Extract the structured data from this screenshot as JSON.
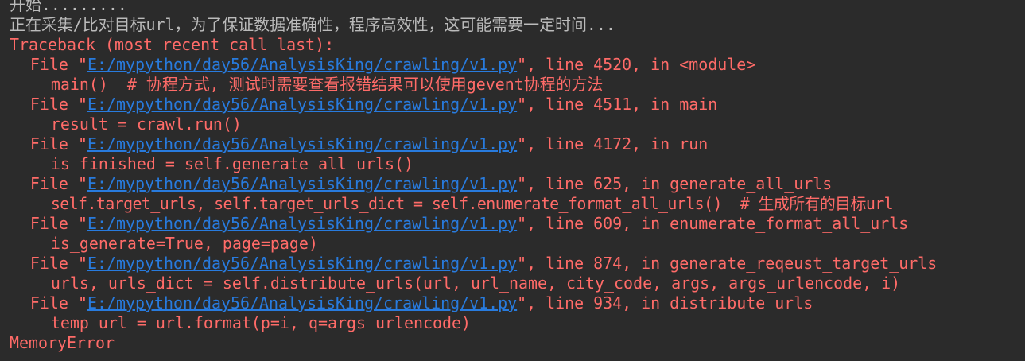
{
  "console": {
    "partial_top_line": "开始.........",
    "status_line": "正在采集/比对目标url，为了保证数据准确性，程序高效性，这可能需要一定时间...",
    "traceback_header": "Traceback (most recent call last):",
    "frames": [
      {
        "file_prefix": "File \"",
        "path": "E:/mypython/day56/AnalysisKing/crawling/v1.py",
        "suffix": "\", line 4520, in <module>",
        "code": "main()  # 协程方式, 测试时需要查看报错结果可以使用gevent协程的方法"
      },
      {
        "file_prefix": "File \"",
        "path": "E:/mypython/day56/AnalysisKing/crawling/v1.py",
        "suffix": "\", line 4511, in main",
        "code": "result = crawl.run()"
      },
      {
        "file_prefix": "File \"",
        "path": "E:/mypython/day56/AnalysisKing/crawling/v1.py",
        "suffix": "\", line 4172, in run",
        "code": "is_finished = self.generate_all_urls()"
      },
      {
        "file_prefix": "File \"",
        "path": "E:/mypython/day56/AnalysisKing/crawling/v1.py",
        "suffix": "\", line 625, in generate_all_urls",
        "code": "self.target_urls, self.target_urls_dict = self.enumerate_format_all_urls()  # 生成所有的目标url"
      },
      {
        "file_prefix": "File \"",
        "path": "E:/mypython/day56/AnalysisKing/crawling/v1.py",
        "suffix": "\", line 609, in enumerate_format_all_urls",
        "code": "is_generate=True, page=page)"
      },
      {
        "file_prefix": "File \"",
        "path": "E:/mypython/day56/AnalysisKing/crawling/v1.py",
        "suffix": "\", line 874, in generate_reqeust_target_urls",
        "code": "urls, urls_dict = self.distribute_urls(url, url_name, city_code, args, args_urlencode, i)"
      },
      {
        "file_prefix": "File \"",
        "path": "E:/mypython/day56/AnalysisKing/crawling/v1.py",
        "suffix": "\", line 934, in distribute_urls",
        "code": "temp_url = url.format(p=i, q=args_urlencode)"
      }
    ],
    "error": "MemoryError"
  },
  "colors": {
    "background": "#2b2b2b",
    "stderr_text": "#ff6b68",
    "stdout_text": "#bbbbbb",
    "link": "#287bde"
  }
}
